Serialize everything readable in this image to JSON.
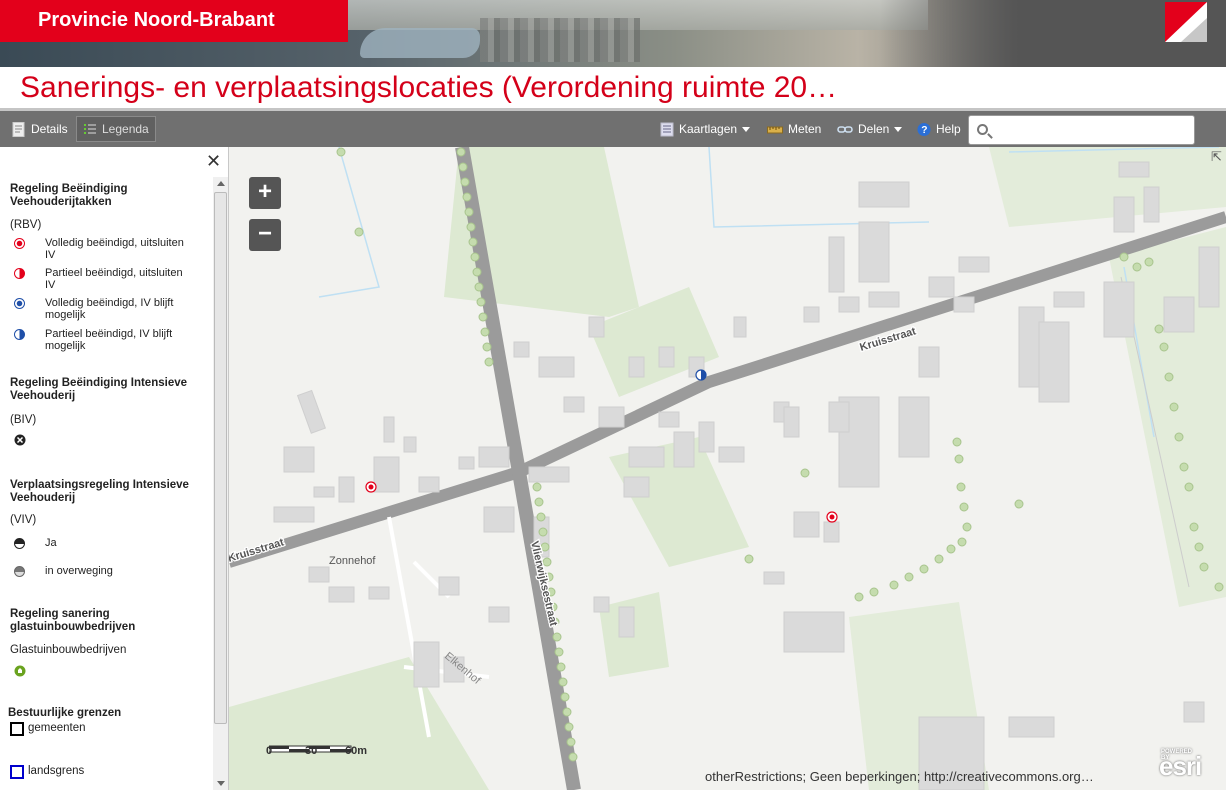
{
  "banner": {
    "brand": "Provincie Noord-Brabant"
  },
  "title": "Sanerings- en verplaatsingslocaties (Verordening ruimte 20…",
  "toolbar": {
    "details": "Details",
    "legend": "Legenda",
    "basemaps": "Kaartlagen",
    "measure": "Meten",
    "share": "Delen",
    "help": "Help",
    "search_value": ""
  },
  "legend": {
    "close": "✕",
    "rbv": {
      "heading": "Regeling Beëindiging Veehouderijtakken",
      "sub": "(RBV)",
      "items": [
        {
          "label": "Volledig beëindigd, uitsluiten IV",
          "color": "#e3001b"
        },
        {
          "label": "Partieel beëindigd, uitsluiten IV",
          "color": "#e3001b"
        },
        {
          "label": "Volledig beëindigd, IV blijft mogelijk",
          "color": "#1f4fa8"
        },
        {
          "label": "Partieel beëindigd, IV blijft mogelijk",
          "color": "#1f4fa8"
        }
      ]
    },
    "biv": {
      "heading": "Regeling Beëindiging Intensieve Veehouderij",
      "sub": "(BIV)"
    },
    "viv": {
      "heading": "Verplaatsingsregeling Intensieve Veehouderij",
      "sub": "(VIV)",
      "items": [
        {
          "label": "Ja"
        },
        {
          "label": "in overweging"
        }
      ]
    },
    "glas": {
      "heading": "Regeling sanering glastuinbouwbedrijven",
      "sub": "Glastuinbouwbedrijven"
    },
    "bounds": {
      "heading": "Bestuurlijke grenzen",
      "items": [
        {
          "label": "gemeenten",
          "color": "#000000"
        },
        {
          "label": "landsgrens",
          "color": "#0000cc"
        }
      ]
    }
  },
  "map": {
    "zoom_in": "+",
    "zoom_out": "−",
    "labels": {
      "kruisstraat_1": "Kruisstraat",
      "kruisstraat_2": "Kruisstraat",
      "vlierwijksestraat": "Vlierwijksestraat",
      "zonnehof": "Zonnehof",
      "elkenhof": "Elkenhof"
    },
    "scale": {
      "ticks": [
        "0",
        "30",
        "60m"
      ]
    },
    "attribution": "otherRestrictions; Geen beperkingen; http://creativecommons.org…",
    "esri": {
      "powered": "POWERED BY",
      "logo": "esri"
    }
  }
}
